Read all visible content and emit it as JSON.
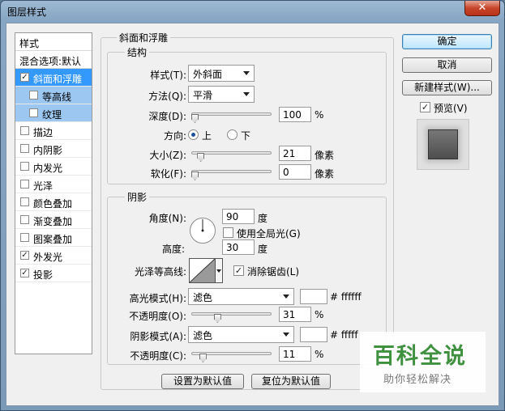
{
  "window": {
    "title": "图层样式",
    "close_glyph": "✕"
  },
  "style_list": {
    "header": "样式",
    "blend_options": "混合选项:默认",
    "items": [
      {
        "label": "斜面和浮雕",
        "checked": true,
        "state": "selected"
      },
      {
        "label": "等高线",
        "checked": false,
        "state": "sub"
      },
      {
        "label": "纹理",
        "checked": false,
        "state": "sub"
      },
      {
        "label": "描边",
        "checked": false
      },
      {
        "label": "内阴影",
        "checked": false
      },
      {
        "label": "内发光",
        "checked": false
      },
      {
        "label": "光泽",
        "checked": false
      },
      {
        "label": "颜色叠加",
        "checked": false
      },
      {
        "label": "渐变叠加",
        "checked": false
      },
      {
        "label": "图案叠加",
        "checked": false
      },
      {
        "label": "外发光",
        "checked": true
      },
      {
        "label": "投影",
        "checked": true
      }
    ]
  },
  "bevel": {
    "group_title": "斜面和浮雕",
    "structure_title": "结构",
    "style_label": "样式(T):",
    "style_value": "外斜面",
    "technique_label": "方法(Q):",
    "technique_value": "平滑",
    "depth_label": "深度(D):",
    "depth_value": "100",
    "depth_unit": "%",
    "depth_level": 0.0,
    "direction_label": "方向:",
    "direction_up": "上",
    "direction_down": "下",
    "size_label": "大小(Z):",
    "size_value": "21",
    "size_unit": "像素",
    "size_level": 0.08,
    "soften_label": "软化(F):",
    "soften_value": "0",
    "soften_unit": "像素",
    "soften_level": 0.0
  },
  "shading": {
    "title": "阴影",
    "angle_label": "角度(N):",
    "angle_value": "90",
    "angle_unit": "度",
    "global_light_label": "使用全局光(G)",
    "global_light": false,
    "altitude_label": "高度:",
    "altitude_value": "30",
    "altitude_unit": "度",
    "gloss_contour_label": "光泽等高线:",
    "anti_aliased_label": "消除锯齿(L)",
    "anti_aliased": true,
    "highlight_mode_label": "高光模式(H):",
    "highlight_mode_value": "滤色",
    "highlight_color": "#ffffff",
    "highlight_color_text": "# ffffff",
    "highlight_opacity_label": "不透明度(O):",
    "highlight_opacity_value": "31",
    "highlight_opacity_unit": "%",
    "highlight_opacity_level": 0.31,
    "shadow_mode_label": "阴影模式(A):",
    "shadow_mode_value": "滤色",
    "shadow_color": "#ffffff",
    "shadow_color_text": "# fffff",
    "shadow_opacity_label": "不透明度(C):",
    "shadow_opacity_value": "11",
    "shadow_opacity_unit": "%",
    "shadow_opacity_level": 0.11
  },
  "buttons": {
    "ok": "确定",
    "cancel": "取消",
    "new_style": "新建样式(W)...",
    "preview_label": "预览(V)",
    "preview_checked": true,
    "make_default": "设置为默认值",
    "reset_default": "复位为默认值"
  },
  "watermark": {
    "big": "百科全说",
    "small": "助你轻松解决"
  }
}
